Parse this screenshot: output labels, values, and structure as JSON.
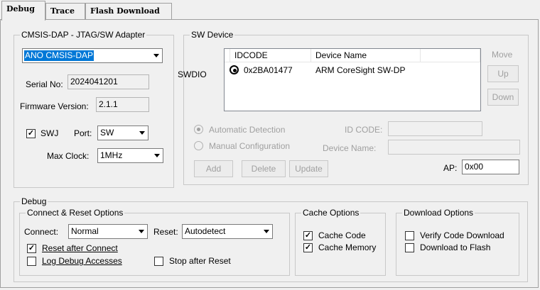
{
  "tabs": [
    "Debug",
    "Trace",
    "Flash Download"
  ],
  "adapter": {
    "title": "CMSIS-DAP - JTAG/SW Adapter",
    "device_selected": "ANO CMSIS-DAP",
    "serial_label": "Serial No:",
    "serial_value": "2024041201",
    "firmware_label": "Firmware Version:",
    "firmware_value": "2.1.1",
    "swj_label": "SWJ",
    "port_label": "Port:",
    "port_value": "SW",
    "clock_label": "Max Clock:",
    "clock_value": "1MHz"
  },
  "sw_device": {
    "title": "SW Device",
    "side_label": "SWDIO",
    "columns": [
      "IDCODE",
      "Device Name"
    ],
    "rows": [
      {
        "idcode": "0x2BA01477",
        "name": "ARM CoreSight SW-DP"
      }
    ],
    "move_label": "Move",
    "up_label": "Up",
    "down_label": "Down",
    "auto_detect_label": "Automatic Detection",
    "manual_config_label": "Manual Configuration",
    "idcode_label": "ID CODE:",
    "devname_label": "Device Name:",
    "add_label": "Add",
    "delete_label": "Delete",
    "update_label": "Update",
    "ap_label": "AP:",
    "ap_value": "0x00"
  },
  "debug": {
    "title": "Debug",
    "connect_reset": {
      "title": "Connect & Reset Options",
      "connect_label": "Connect:",
      "connect_value": "Normal",
      "reset_label": "Reset:",
      "reset_value": "Autodetect",
      "reset_after_connect": "Reset after Connect",
      "log_debug": "Log Debug Accesses",
      "stop_after_reset": "Stop after Reset"
    },
    "cache": {
      "title": "Cache Options",
      "cache_code": "Cache Code",
      "cache_memory": "Cache Memory"
    },
    "download": {
      "title": "Download Options",
      "verify": "Verify Code Download",
      "to_flash": "Download to Flash"
    }
  },
  "checks": {
    "swj": true,
    "reset_after_connect": true,
    "log_debug": false,
    "stop_after_reset": false,
    "cache_code": true,
    "cache_memory": true,
    "verify": false,
    "to_flash": false
  },
  "colors": {
    "selection": "#0078d7",
    "background": "#f0f0f0"
  }
}
